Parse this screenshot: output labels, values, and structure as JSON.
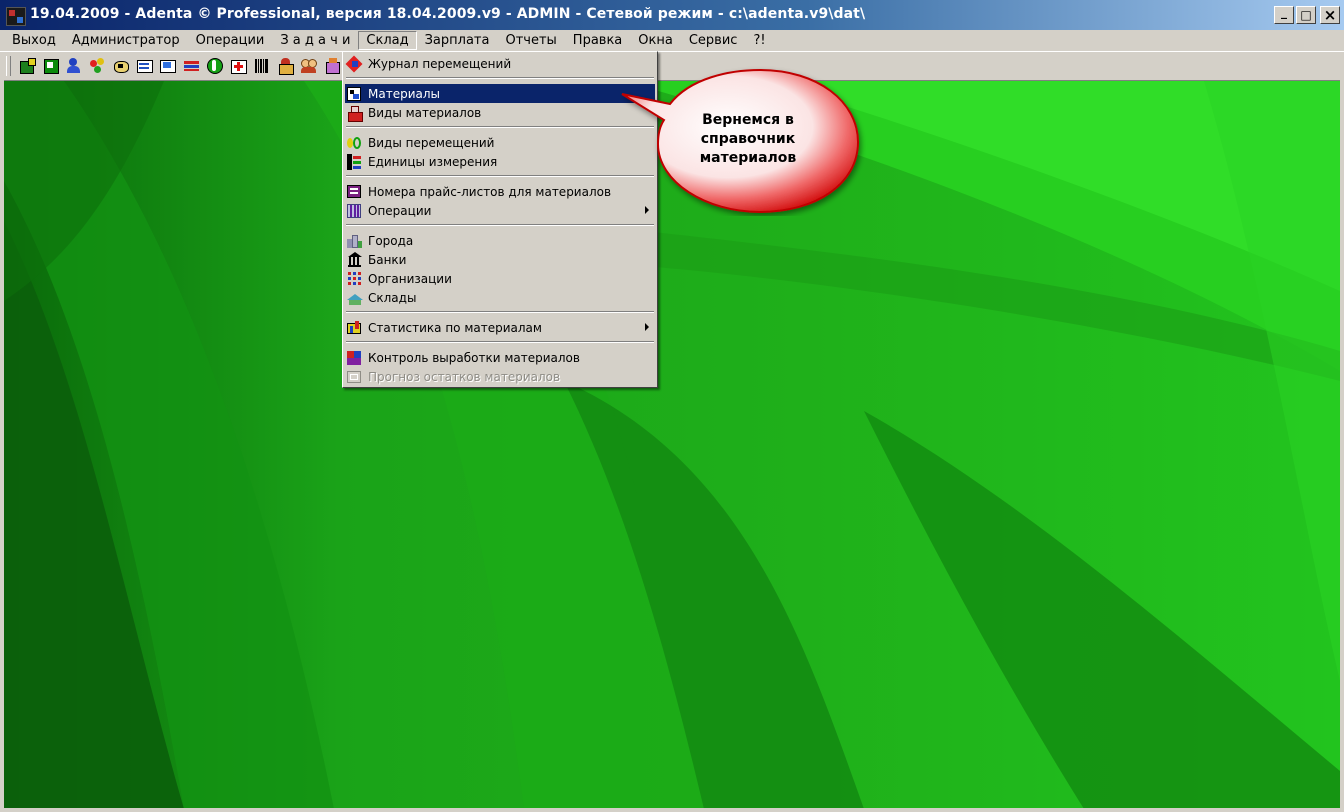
{
  "window": {
    "title": "19.04.2009 - Adenta © Professional, версия 18.04.2009.v9 - ADMIN - Сетевой режим - c:\\adenta.v9\\dat\\",
    "buttons": {
      "minimize": "_",
      "maximize": "□",
      "close": "×"
    }
  },
  "menubar": {
    "items": [
      {
        "label": "Выход"
      },
      {
        "label": "Администратор"
      },
      {
        "label": "Операции"
      },
      {
        "label": "З а д а ч и"
      },
      {
        "label": "Склад"
      },
      {
        "label": "Зарплата"
      },
      {
        "label": "Отчеты"
      },
      {
        "label": "Правка"
      },
      {
        "label": "Окна"
      },
      {
        "label": "Сервис"
      },
      {
        "label": "?!"
      }
    ],
    "active": "Склад"
  },
  "toolbar": {
    "buttons": [
      "toolbar-icon-1",
      "toolbar-icon-2",
      "toolbar-icon-3",
      "toolbar-icon-4",
      "toolbar-icon-5",
      "toolbar-icon-6",
      "toolbar-icon-7",
      "toolbar-icon-8",
      "money-icon",
      "medkit-icon",
      "barcode-icon",
      "toolbar-icon-12",
      "users-icon",
      "box-icon"
    ]
  },
  "dropdown": {
    "items": [
      {
        "label": "Журнал перемещений",
        "icon": "journal-icon"
      },
      {
        "label": "Материалы",
        "icon": "materials-icon",
        "highlighted": true
      },
      {
        "label": "Виды материалов",
        "icon": "material-types-icon"
      },
      {
        "label": "Виды перемещений",
        "icon": "movement-types-icon"
      },
      {
        "label": "Единицы измерения",
        "icon": "units-icon"
      },
      {
        "label": "Номера прайс-листов для материалов",
        "icon": "price-list-icon"
      },
      {
        "label": "Операции",
        "icon": "operations-icon",
        "submenu": true
      },
      {
        "label": "Города",
        "icon": "cities-icon"
      },
      {
        "label": "Банки",
        "icon": "bank-icon"
      },
      {
        "label": "Организации",
        "icon": "organizations-icon"
      },
      {
        "label": "Склады",
        "icon": "warehouses-icon"
      },
      {
        "label": "Статистика по материалам",
        "icon": "statistics-icon",
        "submenu": true
      },
      {
        "label": "Контроль выработки материалов",
        "icon": "control-icon"
      },
      {
        "label": "Прогноз остатков материалов",
        "icon": "forecast-icon",
        "disabled": true
      }
    ]
  },
  "callout": {
    "line1": "Вернемся в",
    "line2": "справочник",
    "line3": "материалов"
  },
  "colors": {
    "title_bar": "#0a246a",
    "highlight": "#0a246a",
    "desktop_green": "#17a315",
    "callout_red": "#e01010"
  }
}
